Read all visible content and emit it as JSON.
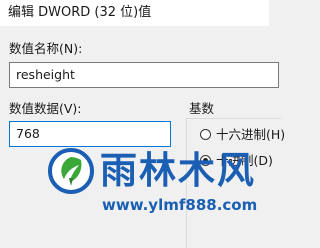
{
  "window": {
    "title": "编辑 DWORD (32 位)值"
  },
  "value_name": {
    "label": "数值名称(N):",
    "value": "resheight"
  },
  "value_data": {
    "label": "数值数据(V):",
    "value": "768"
  },
  "base": {
    "label": "基数",
    "options": [
      {
        "label": "十六进制(H)",
        "selected": false
      },
      {
        "label": "十进制(D)",
        "selected": true
      }
    ]
  },
  "watermark": {
    "name": "雨林木风",
    "url": "www.ylmf888.com"
  },
  "colors": {
    "accent": "#0078d7",
    "watermark": "#1a5fb4",
    "logo_green": "#3aa838"
  }
}
